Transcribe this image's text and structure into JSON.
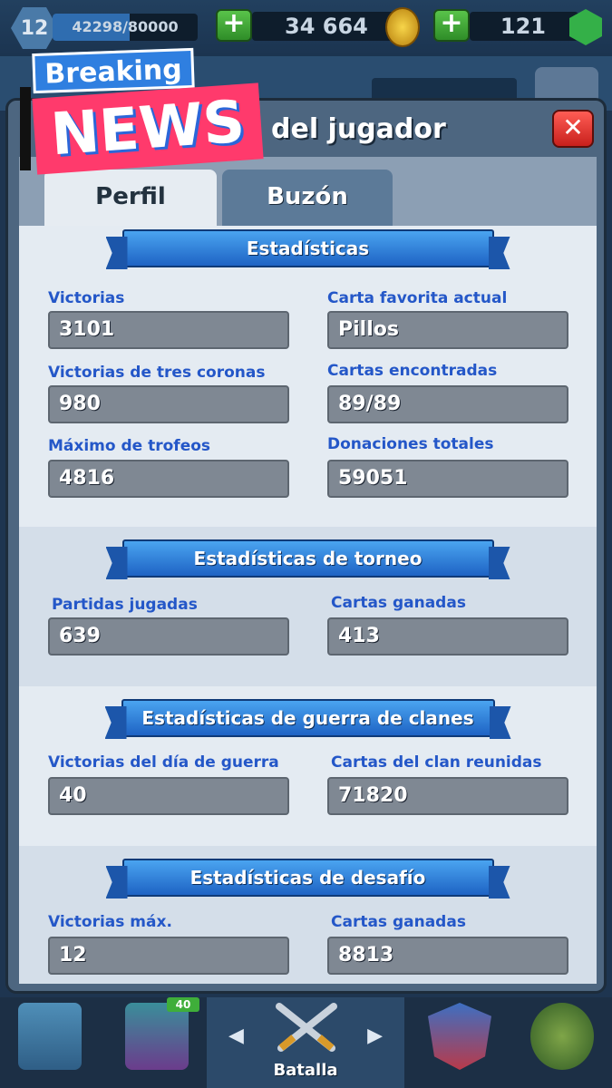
{
  "topbar": {
    "level": "12",
    "xp_text": "42298/80000",
    "xp_progress": 0.53,
    "gold": "34 664",
    "gems": "121",
    "plus_label": "+"
  },
  "overlay": {
    "breaking": "Breaking",
    "news": "NEWS"
  },
  "modal": {
    "title": "del jugador",
    "close_label": "✕",
    "tabs": [
      {
        "label": "Perfil",
        "active": true
      },
      {
        "label": "Buzón",
        "active": false
      }
    ]
  },
  "sections": {
    "general": {
      "title": "Estadísticas",
      "stats": [
        {
          "label": "Victorias",
          "value": "3101"
        },
        {
          "label": "Carta favorita actual",
          "value": "Pillos"
        },
        {
          "label": "Victorias de tres coronas",
          "value": "980"
        },
        {
          "label": "Cartas encontradas",
          "value": "89/89"
        },
        {
          "label": "Máximo de trofeos",
          "value": "4816"
        },
        {
          "label": "Donaciones totales",
          "value": "59051"
        }
      ]
    },
    "tournament": {
      "title": "Estadísticas de torneo",
      "stats": [
        {
          "label": "Partidas jugadas",
          "value": "639"
        },
        {
          "label": "Cartas ganadas",
          "value": "413"
        }
      ]
    },
    "clan_war": {
      "title": "Estadísticas de guerra de clanes",
      "stats": [
        {
          "label": "Victorias del día de guerra",
          "value": "40"
        },
        {
          "label": "Cartas del clan reunidas",
          "value": "71820"
        }
      ]
    },
    "challenge": {
      "title": "Estadísticas de desafío",
      "stats": [
        {
          "label": "Victorias máx.",
          "value": "12"
        },
        {
          "label": "Cartas ganadas",
          "value": "8813"
        }
      ]
    }
  },
  "bottom_nav": {
    "battle_label": "Batalla",
    "cards_badge": "40",
    "icons": [
      "chest-icon",
      "cards-icon",
      "swords-icon",
      "clan-icon",
      "tournament-icon"
    ]
  },
  "colors": {
    "accent_blue": "#2457c8",
    "ribbon_blue": "#2f7fe0",
    "close_red": "#e0302a",
    "news_pink": "#ff3a6c"
  }
}
